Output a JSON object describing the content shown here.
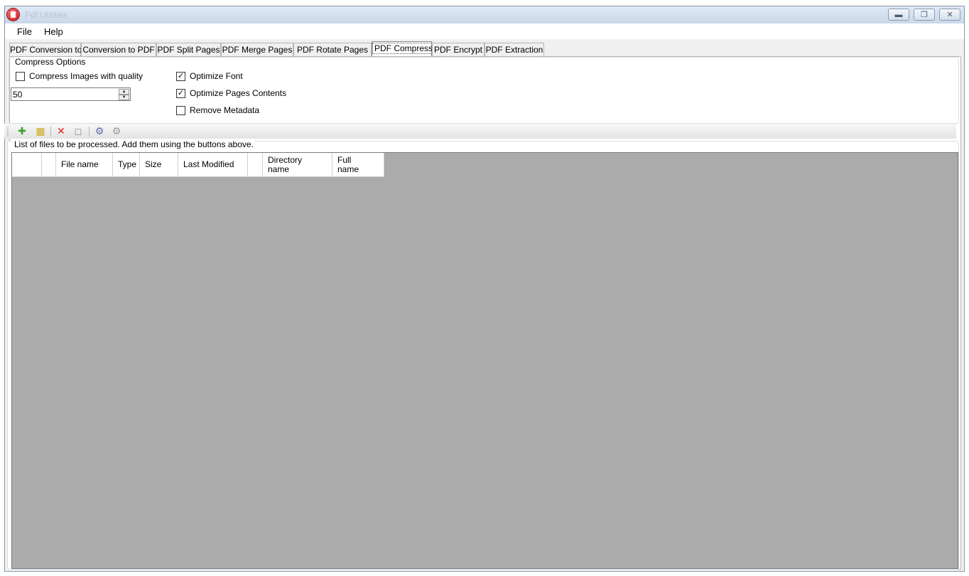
{
  "window": {
    "title": "Pdf Utilities"
  },
  "menu": {
    "items": [
      "File",
      "Help"
    ]
  },
  "tabs": [
    "PDF Conversion to",
    "Conversion to PDF",
    "PDF Split Pages",
    "PDF Merge Pages",
    "PDF Rotate Pages",
    "PDF Compress",
    "PDF Encrypt",
    "PDF Extraction"
  ],
  "compress": {
    "group_label": "Compress Options",
    "images_label": "Compress Images with quality",
    "images_checked": false,
    "quality_value": "50",
    "font_label": "Optimize Font",
    "font_checked": true,
    "pages_label": "Optimize Pages Contents",
    "pages_checked": true,
    "metadata_label": "Remove Metadata",
    "metadata_checked": false
  },
  "toolbar": {
    "icons": [
      "add-file-icon",
      "add-folder-icon",
      "delete-icon",
      "blank-page-icon",
      "process-icon",
      "process-all-icon"
    ]
  },
  "filelist": {
    "label": "List of files to be processed. Add  them using the buttons above.",
    "columns": [
      "",
      "",
      "File name",
      "Type",
      "Size",
      "Last Modified",
      "",
      "Directory name",
      "Full name"
    ]
  }
}
